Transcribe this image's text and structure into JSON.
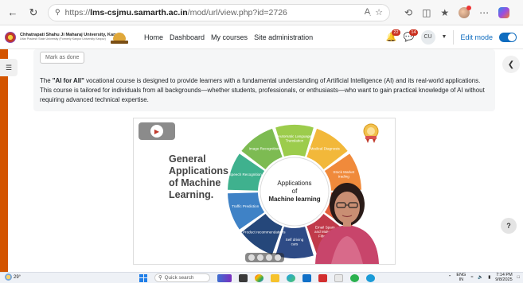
{
  "browser": {
    "url_prefix": "https://",
    "url_host": "lms-csjmu.samarth.ac.in",
    "url_path": "/mod/url/view.php?id=2726",
    "back_icon": "back-arrow-icon",
    "refresh_icon": "refresh-icon",
    "lock_icon": "lock-icon"
  },
  "site": {
    "university_name": "Chhatrapati Shahu Ji Maharaj University, Kanpur",
    "university_subtitle": "Uttar Pradesh State University (Formerly Kanpur University Kanpur)",
    "nav": [
      "Home",
      "Dashboard",
      "My courses",
      "Site administration"
    ],
    "notifications_count": "22",
    "messages_count": "14",
    "user_initials": "CU",
    "edit_mode_label": "Edit mode",
    "edit_mode_on": true
  },
  "content": {
    "mark_done_label": "Mark as done",
    "desc_pre": "The ",
    "desc_bold": "\"AI for All\"",
    "desc_post": " vocational course is designed to provide learners with a fundamental understanding of Artificial Intelligence (AI) and its real-world applications. This course is tailored for individuals from all backgrounds—whether students, professionals, or enthusiasts—who want to gain practical knowledge of AI without requiring advanced technical expertise."
  },
  "video": {
    "heading_lines": [
      "General",
      "Applications",
      "of Machine",
      "Learning."
    ],
    "wheel_center_lines": [
      "Applications",
      "of"
    ],
    "wheel_center_bold": "Machine learning",
    "segments": [
      {
        "label": "Automatic Language Translation",
        "color": "#9ccc4c"
      },
      {
        "label": "Medical Diagnosis",
        "color": "#f2b83a"
      },
      {
        "label": "Stock Market trading",
        "color": "#f08a3b"
      },
      {
        "label": "Online Fraud Detection",
        "color": "#e4603c"
      },
      {
        "label": "Email Spam and Malware Filtering",
        "color": "#c03a4a"
      },
      {
        "label": "Self driving cars",
        "color": "#2e4b86"
      },
      {
        "label": "Product recommendations",
        "color": "#25477a"
      },
      {
        "label": "Traffic Prediction",
        "color": "#3f82c6"
      },
      {
        "label": "Speech Recognition",
        "color": "#3fb18e"
      },
      {
        "label": "Image Recognition",
        "color": "#7dbb52"
      }
    ]
  },
  "taskbar": {
    "temperature": "29°",
    "search_placeholder": "Quick search",
    "lang_top": "ENG",
    "lang_bottom": "IN",
    "time": "7:14 PM",
    "date": "9/8/2025"
  },
  "colors": {
    "accent": "#0f6cbf",
    "badge": "#ca3120",
    "rail": "#d35400"
  }
}
